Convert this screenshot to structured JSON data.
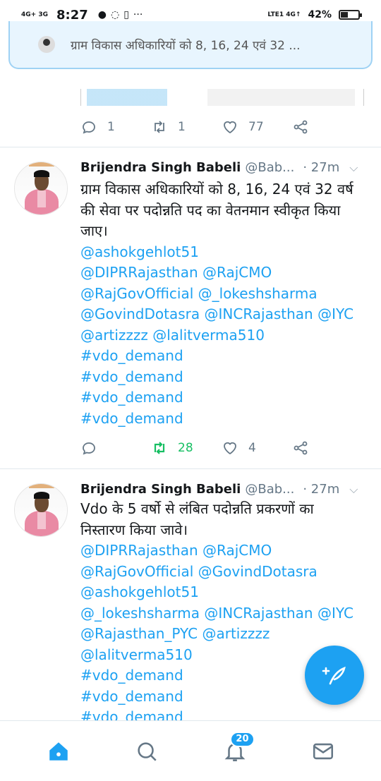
{
  "status_bar": {
    "network_left": "4G+ 3G",
    "time": "8:27",
    "network_right": "LTE1 4G↑",
    "battery_percent": "42%",
    "battery_level": 0.42,
    "icons": [
      "chat-bubble-icon",
      "whatsapp-icon",
      "sim-icon",
      "more-dots-icon"
    ]
  },
  "banner": {
    "text": "ग्राम विकास अधिकारियों को 8, 16, 24 एवं 32 ..."
  },
  "prev_tweet": {
    "reply_count": "1",
    "retweet_count": "1",
    "like_count": "77"
  },
  "tweets": [
    {
      "name": "Brijendra Singh Babeli",
      "handle": "@Bab...",
      "time": "· 27m",
      "lines": [
        {
          "text": "ग्राम विकास अधिकारियों को 8, 16, 24 एवं 32 वर्ष",
          "link": false
        },
        {
          "text": "की सेवा पर पदोन्नति पद का वेतनमान स्वीकृत किया",
          "link": false
        },
        {
          "text": "जाए।",
          "link": false
        },
        {
          "text": "@ashokgehlot51",
          "link": true
        },
        {
          "text": "@DIPRRajasthan @RajCMO",
          "link": true
        },
        {
          "text": "@RajGovOfficial @_lokeshsharma",
          "link": true
        },
        {
          "text": "@GovindDotasra @INCRajasthan @IYC",
          "link": true
        },
        {
          "text": "@artizzzz @lalitverma510",
          "link": true
        },
        {
          "text": "#vdo_demand",
          "link": true
        },
        {
          "text": "#vdo_demand",
          "link": true
        },
        {
          "text": "#vdo_demand",
          "link": true
        },
        {
          "text": "#vdo_demand",
          "link": true
        }
      ],
      "reply_count": "",
      "retweet_count": "28",
      "like_count": "4"
    },
    {
      "name": "Brijendra Singh Babeli",
      "handle": "@Bab...",
      "time": "· 27m",
      "lines": [
        {
          "text": "Vdo के 5 वर्षो से लंबित पदोन्नति प्रकरणों का",
          "link": false
        },
        {
          "text": "निस्तारण किया जावे।",
          "link": false
        },
        {
          "text": "@DIPRRajasthan @RajCMO",
          "link": true
        },
        {
          "text": "@RajGovOfficial @GovindDotasra",
          "link": true
        },
        {
          "text": "@ashokgehlot51",
          "link": true
        },
        {
          "text": "@_lokeshsharma @INCRajasthan @IYC",
          "link": true
        },
        {
          "text": "@Rajasthan_PYC @artizzzz",
          "link": true
        },
        {
          "text": "@lalitverma510",
          "link": true
        },
        {
          "text": "#vdo_demand",
          "link": true
        },
        {
          "text": "#vdo_demand",
          "link": true
        },
        {
          "text": "#vdo_demand",
          "link": true
        }
      ]
    }
  ],
  "bottom_nav": {
    "notification_count": "20",
    "items": [
      "home-icon",
      "search-icon",
      "notifications-icon",
      "messages-icon"
    ]
  },
  "colors": {
    "accent": "#1da1f2",
    "retweet_active": "#17bf63",
    "muted": "#657786"
  }
}
